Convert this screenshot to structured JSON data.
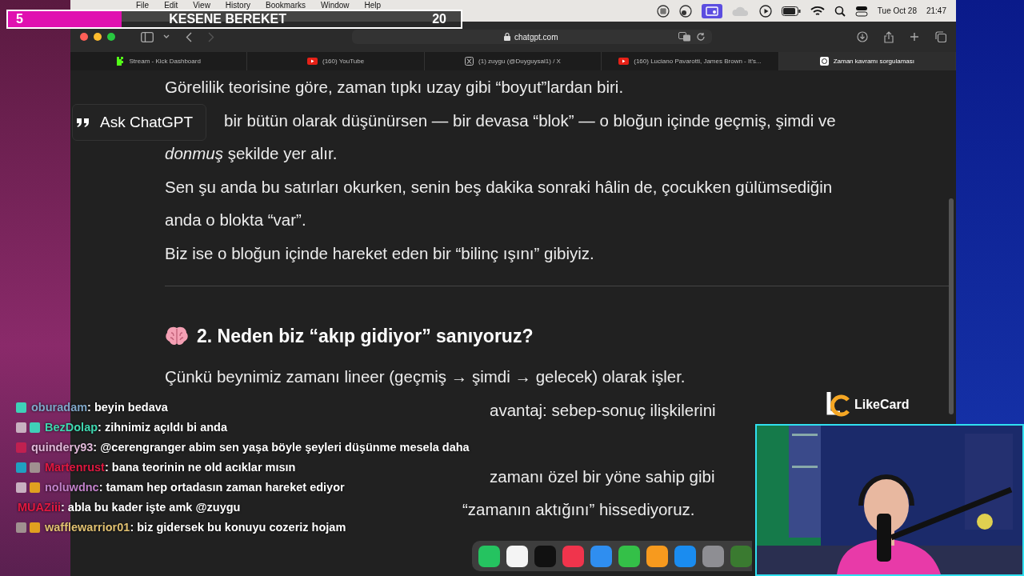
{
  "goal_bar": {
    "count": "5",
    "title": "KESENE BEREKET",
    "target": "20",
    "level": 0.25
  },
  "menu_bar": {
    "items": [
      "File",
      "Edit",
      "View",
      "History",
      "Bookmarks",
      "Window",
      "Help"
    ],
    "date": "Tue Oct 28",
    "time": "21:47"
  },
  "toolbar": {
    "address": "chatgpt.com"
  },
  "tabs": [
    {
      "label": "Stream - Kick Dashboard",
      "kind": "kick",
      "selected": false
    },
    {
      "label": "(160) YouTube",
      "kind": "video",
      "selected": false
    },
    {
      "label": "(1) zuygu (@Duyguysal1) / X",
      "kind": "x",
      "selected": false
    },
    {
      "label": "(160) Luciano Pavarotti, James Brown - It's...",
      "kind": "video",
      "selected": false
    },
    {
      "label": "Zaman kavramı sorgulaması",
      "kind": "chat",
      "selected": true
    }
  ],
  "ask_popup": {
    "label": "Ask ChatGPT"
  },
  "article": {
    "lines": [
      {
        "kind": "full",
        "text": "Görelilik teorisine göre, zaman tıpkı uzay gibi “boyut”lardan biri."
      },
      {
        "kind": "after-popup",
        "text": "bir bütün olarak düşünürsen — bir devasa “blok” — o bloğun içinde geçmiş, şimdi ve"
      },
      {
        "kind": "full",
        "text": "*donmuş* şekilde yer alır."
      },
      {
        "kind": "full",
        "text": "Sen şu anda bu satırları okurken, senin beş dakika sonraki hâlin de, çocukken gülümsediğin"
      },
      {
        "kind": "full",
        "text": "anda o blokta “var”."
      },
      {
        "kind": "full",
        "text": "Biz ise o bloğun içinde hareket eden bir “bilinç ışını” gibiyiz."
      }
    ],
    "heading": "2. Neden biz “akıp gidiyor” sanıyoruz?",
    "lines_after": [
      {
        "kind": "full",
        "text": "Çünkü beynimiz zamanı lineer (geçmiş → şimdi → gelecek) olarak işler."
      },
      {
        "kind": "fragment",
        "text": "avantaj: sebep-sonuç ilişkilerini"
      },
      {
        "kind": "fragment-low",
        "text": "zamanı özel bir yöne sahip gibi"
      },
      {
        "kind": "fragment-left",
        "text": "“zamanın aktığını” hissediyoruz."
      }
    ]
  },
  "chat": [
    {
      "user": "oburadam",
      "color": "#7fa6c8",
      "badges": [
        {
          "color": "#3fd0b8"
        }
      ],
      "message": ": beyin bedava"
    },
    {
      "user": "BezDolap",
      "color": "#3fd8b0",
      "badges": [
        {
          "color": "#c8b0c0"
        },
        {
          "color": "#3fd0b8"
        }
      ],
      "message": ": zihnimiz açıldı bi anda"
    },
    {
      "user": "quindery93",
      "color": "#e0b8d8",
      "badges": [
        {
          "color": "#c02050"
        }
      ],
      "message": ": @cerengranger abim sen yaşa böyle şeyleri düşünme mesela daha"
    },
    {
      "user": "Martenrust",
      "color": "#e01840",
      "badges": [
        {
          "color": "#20a0c0"
        },
        {
          "color": "#a09090"
        }
      ],
      "message": ": bana teorinin ne old acıklar mısın"
    },
    {
      "user": "noluwdnc",
      "color": "#c080c8",
      "badges": [
        {
          "color": "#c8b0c0"
        },
        {
          "color": "#e0a020"
        }
      ],
      "message": ": tamam hep ortadasın zaman hareket ediyor"
    },
    {
      "user": "MUAZiii",
      "color": "#e01840",
      "message": ": abla bu kader işte amk @zuygu"
    },
    {
      "user": "wafflewarrior01",
      "color": "#e0c070",
      "badges": [
        {
          "color": "#a09090"
        },
        {
          "color": "#e0a020"
        }
      ],
      "message": ": biz gidersek bu konuyu cozeriz hojam"
    }
  ],
  "sponsor": {
    "name": "LikeCard"
  },
  "dock": [
    {
      "color": "#25c360"
    },
    {
      "color": "#f4f4f4"
    },
    {
      "color": "#111111"
    },
    {
      "color": "#f0344c"
    },
    {
      "color": "#2f8ef0"
    },
    {
      "color": "#34c048"
    },
    {
      "color": "#f79a1e"
    },
    {
      "color": "#1a8cf0"
    },
    {
      "color": "#8e8e93"
    },
    {
      "color": "#3a7a30"
    }
  ]
}
